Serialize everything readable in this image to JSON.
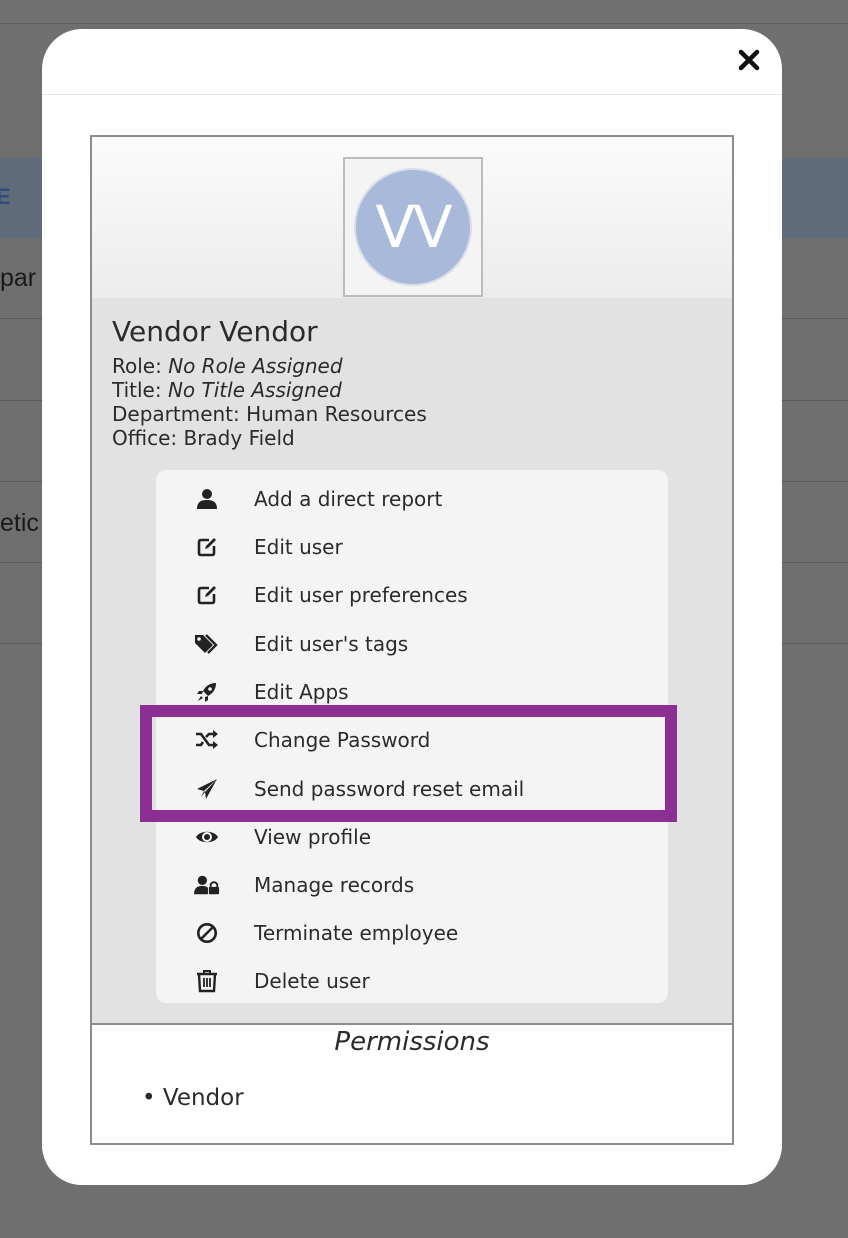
{
  "background": {
    "header_text": "E",
    "rows": [
      "par",
      "",
      "",
      "etic",
      ""
    ]
  },
  "modal": {
    "close_icon": "close-icon"
  },
  "user": {
    "initials": "VV",
    "name": "Vendor Vendor",
    "role_label": "Role:",
    "role_value": "No Role Assigned",
    "title_label": "Title:",
    "title_value": "No Title Assigned",
    "department_label": "Department:",
    "department_value": "Human Resources",
    "office_label": "Office:",
    "office_value": "Brady Field"
  },
  "menu": {
    "items": [
      {
        "label": "Add a direct report",
        "icon": "user-icon"
      },
      {
        "label": "Edit user",
        "icon": "edit-icon"
      },
      {
        "label": "Edit user preferences",
        "icon": "edit-icon"
      },
      {
        "label": "Edit user's tags",
        "icon": "tags-icon"
      },
      {
        "label": "Edit Apps",
        "icon": "rocket-icon"
      },
      {
        "label": "Change Password",
        "icon": "shuffle-icon"
      },
      {
        "label": "Send password reset email",
        "icon": "paper-plane-icon"
      },
      {
        "label": "View profile",
        "icon": "eye-icon"
      },
      {
        "label": "Manage records",
        "icon": "user-lock-icon"
      },
      {
        "label": "Terminate employee",
        "icon": "ban-icon"
      },
      {
        "label": "Delete user",
        "icon": "trash-icon"
      }
    ]
  },
  "permissions": {
    "title": "Permissions",
    "items": [
      "• Vendor"
    ]
  },
  "colors": {
    "highlight": "#8c2f93",
    "avatar": "#a8b9da",
    "info_bg": "#e2e2e2",
    "menu_bg": "#f4f4f4"
  }
}
